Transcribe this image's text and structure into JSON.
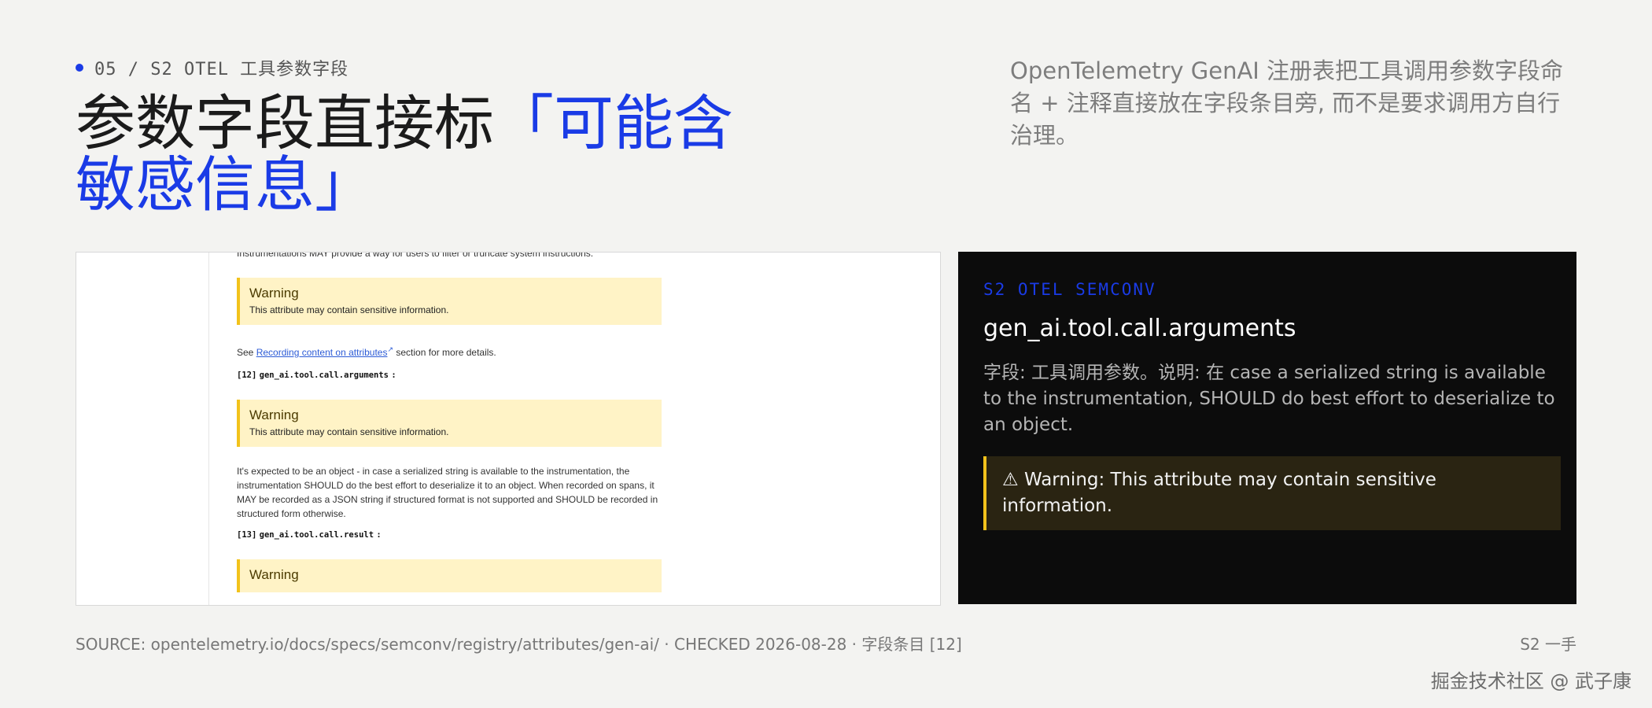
{
  "eyebrow": "05 / S2 OTEL 工具参数字段",
  "headline": {
    "plain": "参数字段直接标",
    "accent": "「可能含敏感信息」"
  },
  "intro": "OpenTelemetry GenAI 注册表把工具调用参数字段命名 + 注释直接放在字段条目旁, 而不是要求调用方自行治理。",
  "doc": {
    "line_top": "Instrumentations MAY provide a way for users to filter or truncate system instructions.",
    "warning_title": "Warning",
    "warning_body": "This attribute may contain sensitive information.",
    "see_prefix": "See ",
    "see_link": "Recording content on attributes",
    "see_suffix": " section for more details.",
    "field12_num": "[12]",
    "field12_name": "gen_ai.tool.call.arguments",
    "field12_colon": ":",
    "expected_text": "It's expected to be an object - in case a serialized string is available to the instrumentation, the instrumentation SHOULD do the best effort to deserialize it to an object. When recorded on spans, it MAY be recorded as a JSON string if structured format is not supported and SHOULD be recorded in structured form otherwise.",
    "field13_num": "[13]",
    "field13_name": "gen_ai.tool.call.result",
    "field13_colon": ":"
  },
  "card": {
    "tag": "S2 OTEL SEMCONV",
    "title": "gen_ai.tool.call.arguments",
    "desc": "字段: 工具调用参数。说明: 在 case a serialized string is available to the instrumentation, SHOULD do best effort to deserialize to an object.",
    "warning_icon": "⚠",
    "warning": "Warning: This attribute may contain sensitive information."
  },
  "source": "SOURCE: opentelemetry.io/docs/specs/semconv/registry/attributes/gen-ai/ · CHECKED 2026-08-28 · 字段条目 [12]",
  "slide_tag": "S2 一手",
  "watermark": "掘金技术社区 @ 武子康",
  "colors": {
    "accent": "#1a3be6",
    "warning": "#f2c21b",
    "card_bg": "#0c0c0c",
    "page_bg": "#f3f3f1"
  }
}
